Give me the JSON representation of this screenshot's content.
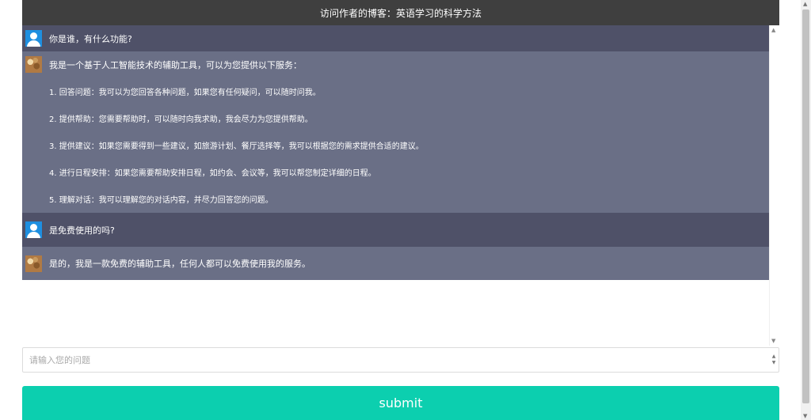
{
  "header": {
    "title": "访问作者的博客：英语学习的科学方法"
  },
  "chat": {
    "messages": [
      {
        "role": "user",
        "avatar_icon": "user-avatar-icon",
        "lines": [
          "你是谁，有什么功能?"
        ]
      },
      {
        "role": "bot",
        "avatar_icon": "bot-avatar-icon",
        "lines": [
          "我是一个基于人工智能技术的辅助工具，可以为您提供以下服务：",
          "1. 回答问题：我可以为您回答各种问题，如果您有任何疑问，可以随时问我。",
          "2. 提供帮助：您需要帮助时，可以随时向我求助，我会尽力为您提供帮助。",
          "3. 提供建议：如果您需要得到一些建议，如旅游计划、餐厅选择等，我可以根据您的需求提供合适的建议。",
          "4. 进行日程安排：如果您需要帮助安排日程，如约会、会议等，我可以帮您制定详细的日程。",
          "5. 理解对话：我可以理解您的对话内容，并尽力回答您的问题。"
        ]
      },
      {
        "role": "user",
        "avatar_icon": "user-avatar-icon",
        "lines": [
          "是免费使用的吗?"
        ]
      },
      {
        "role": "bot",
        "avatar_icon": "bot-avatar-icon",
        "lines": [
          "是的，我是一款免费的辅助工具，任何人都可以免费使用我的服务。"
        ]
      }
    ]
  },
  "input": {
    "value": "",
    "placeholder": "请输入您的问题"
  },
  "submit": {
    "label": "submit"
  },
  "colors": {
    "header_bg": "#3f3f3f",
    "user_bg": "#4f5168",
    "bot_bg": "#6a6f86",
    "submit_bg": "#0ccfaf"
  }
}
